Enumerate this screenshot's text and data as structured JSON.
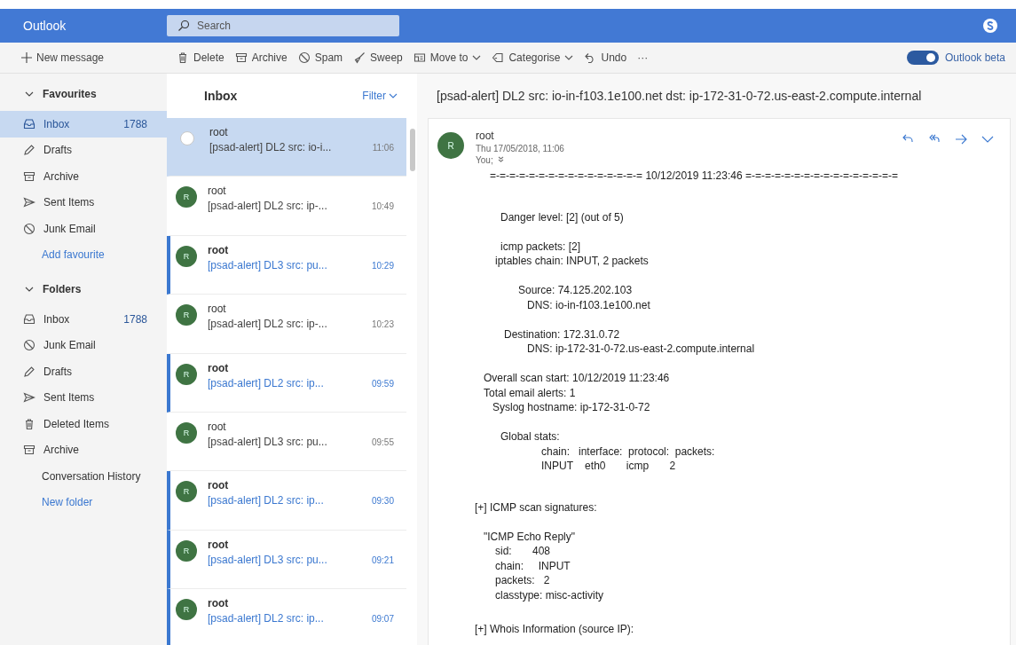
{
  "header": {
    "app_name": "Outlook",
    "search": {
      "placeholder": "Search"
    }
  },
  "toolbar": {
    "new_message": "New message",
    "actions": [
      {
        "kind": "delete",
        "label": "Delete",
        "dropdown": false
      },
      {
        "kind": "archive",
        "label": "Archive",
        "dropdown": false
      },
      {
        "kind": "spam",
        "label": "Spam",
        "dropdown": false
      },
      {
        "kind": "sweep",
        "label": "Sweep",
        "dropdown": false
      },
      {
        "kind": "move",
        "label": "Move to",
        "dropdown": true
      },
      {
        "kind": "categorise",
        "label": "Categorise",
        "dropdown": true
      },
      {
        "kind": "undo",
        "label": "Undo",
        "dropdown": false
      },
      {
        "kind": "more",
        "label": "···",
        "dropdown": false
      }
    ],
    "beta_toggle": {
      "label": "Outlook beta",
      "on": true
    }
  },
  "sidebar": {
    "sections": [
      {
        "title": "Favourites",
        "expanded": true,
        "items": [
          {
            "kind": "inbox",
            "label": "Inbox",
            "count": "1788",
            "selected": true
          },
          {
            "kind": "drafts",
            "label": "Drafts",
            "selected": false
          },
          {
            "kind": "archive",
            "label": "Archive",
            "selected": false
          },
          {
            "kind": "sent",
            "label": "Sent Items",
            "selected": false
          },
          {
            "kind": "junk",
            "label": "Junk Email",
            "selected": false
          },
          {
            "kind": "link",
            "label": "Add favourite",
            "selected": false
          }
        ]
      },
      {
        "title": "Folders",
        "expanded": true,
        "items": [
          {
            "kind": "inbox",
            "label": "Inbox",
            "count": "1788",
            "selected": false
          },
          {
            "kind": "junk",
            "label": "Junk Email",
            "selected": false
          },
          {
            "kind": "drafts",
            "label": "Drafts",
            "selected": false
          },
          {
            "kind": "sent",
            "label": "Sent Items",
            "selected": false
          },
          {
            "kind": "deleted",
            "label": "Deleted Items",
            "selected": false
          },
          {
            "kind": "archive",
            "label": "Archive",
            "selected": false
          },
          {
            "kind": "plain",
            "label": "Conversation History",
            "selected": false
          },
          {
            "kind": "link",
            "label": "New folder",
            "selected": false
          }
        ]
      }
    ]
  },
  "message_list": {
    "title": "Inbox",
    "filter": "Filter",
    "messages": [
      {
        "sender": "root",
        "subject": "[psad-alert] DL2 src: io-i...",
        "time": "11:06",
        "unread": false,
        "selected": true
      },
      {
        "sender": "root",
        "subject": "[psad-alert] DL2 src: ip-...",
        "time": "10:49",
        "avatar": "R",
        "unread": false,
        "selected": false
      },
      {
        "sender": "root",
        "subject": "[psad-alert] DL3 src: pu...",
        "time": "10:29",
        "avatar": "R",
        "unread": true,
        "selected": false
      },
      {
        "sender": "root",
        "subject": "[psad-alert] DL2 src: ip-...",
        "time": "10:23",
        "avatar": "R",
        "unread": false,
        "selected": false
      },
      {
        "sender": "root",
        "subject": "[psad-alert] DL2 src: ip...",
        "time": "09:59",
        "avatar": "R",
        "unread": true,
        "selected": false
      },
      {
        "sender": "root",
        "subject": "[psad-alert] DL3 src: pu...",
        "time": "09:55",
        "avatar": "R",
        "unread": false,
        "selected": false
      },
      {
        "sender": "root",
        "subject": "[psad-alert] DL2 src: ip...",
        "time": "09:30",
        "avatar": "R",
        "unread": true,
        "selected": false
      },
      {
        "sender": "root",
        "subject": "[psad-alert] DL3 src: pu...",
        "time": "09:21",
        "avatar": "R",
        "unread": true,
        "selected": false
      },
      {
        "sender": "root",
        "subject": "[psad-alert] DL2 src: ip...",
        "time": "09:07",
        "avatar": "R",
        "unread": true,
        "selected": false
      }
    ]
  },
  "reading_pane": {
    "subject": "[psad-alert] DL2 src: io-in-f103.1e100.net dst: ip-172-31-0-72.us-east-2.compute.internal",
    "sender": "root",
    "avatar": "R",
    "date": "Thu 17/05/2018, 11:06",
    "recipients": "You;",
    "body": [
      [
        "=-=-=-=-=-=-=-=-=-=-=-=-=-=-=-= 10/12/2019 11:23:46 =-=-=-=-=-=-=-=-=-=-=-=-=-=-=-="
      ],
      [
        "Danger level: [2] (out of 5)"
      ],
      [
        "icmp packets: [2]",
        "iptables chain: INPUT, 2 packets"
      ],
      [
        "Source: 74.125.202.103",
        "DNS: io-in-f103.1e100.net"
      ],
      [
        "Destination: 172.31.0.72",
        "DNS: ip-172-31-0-72.us-east-2.compute.internal"
      ],
      [
        "Overall scan start: 10/12/2019 11:23:46",
        "Total email alerts: 1",
        "Syslog hostname: ip-172-31-0-72"
      ],
      [
        "Global stats:",
        "chain:   interface:  protocol:  packets:",
        "INPUT    eth0       icmp       2"
      ],
      [
        "[+] ICMP scan signatures:"
      ],
      [
        "\"ICMP Echo Reply\"",
        "sid:       408",
        "chain:     INPUT",
        "packets:   2",
        "classtype: misc-activity"
      ],
      [
        "[+] Whois Information (source IP):"
      ]
    ]
  }
}
